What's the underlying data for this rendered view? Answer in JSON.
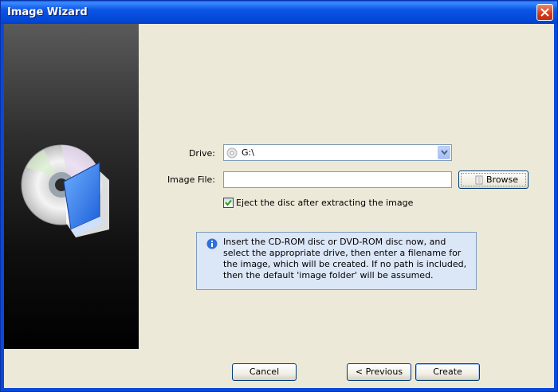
{
  "window": {
    "title": "Image Wizard"
  },
  "form": {
    "drive_label": "Drive:",
    "drive_value": "G:\\",
    "image_file_label": "Image File:",
    "image_file_value": "",
    "browse_label": "Browse",
    "eject_label": "Eject the disc after extracting the image",
    "eject_checked": true
  },
  "info": {
    "text": "Insert the CD-ROM disc or DVD-ROM disc now, and select the appropriate drive, then enter a filename for the image, which will be created.  If no path is included, then the default 'image folder' will be assumed."
  },
  "buttons": {
    "cancel": "Cancel",
    "previous": "< Previous",
    "create": "Create"
  },
  "colors": {
    "title_bar": "#0a54e4",
    "dialog_bg": "#ece9d8",
    "info_bg": "#dbe6f6"
  }
}
